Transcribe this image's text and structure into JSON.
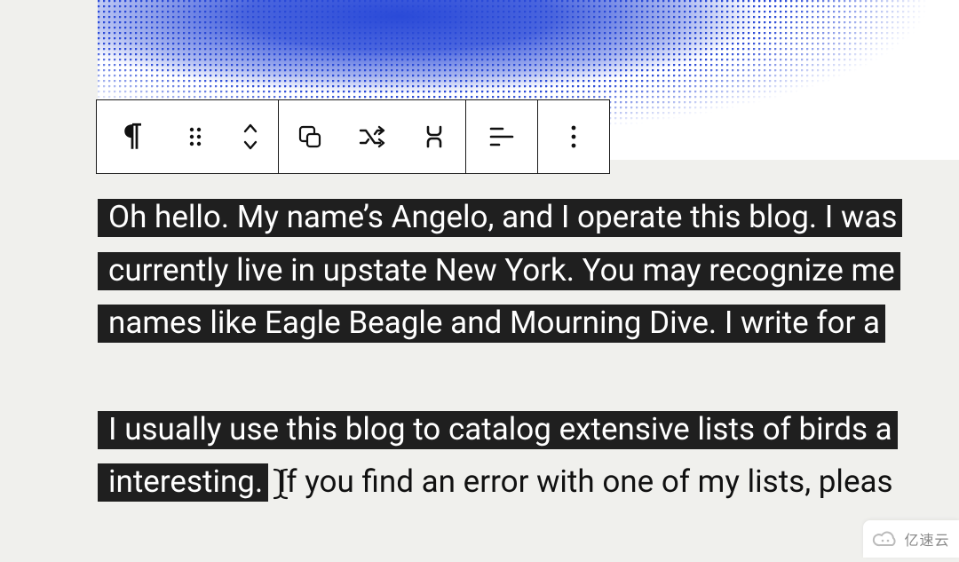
{
  "toolbar": {
    "block_type_icon": "pilcrow",
    "drag_icon": "drag-handle",
    "move_icon": "move-updown",
    "transform_icon": "group",
    "shuffle_icon": "shuffle",
    "split_icon": "split",
    "align_icon": "align-left",
    "more_icon": "more-vertical"
  },
  "content": {
    "paragraphs": [
      {
        "lines": [
          {
            "selected": "Oh hello. My name’s Angelo, and I operate this blog. I was",
            "unselected": ""
          },
          {
            "selected": "currently live in upstate New York. You may recognize me",
            "unselected": ""
          },
          {
            "selected": "names like Eagle Beagle and Mourning Dive. I write for a ",
            "unselected": ""
          }
        ]
      },
      {
        "lines": [
          {
            "selected": "I usually use this blog to catalog extensive lists of birds a",
            "unselected": ""
          },
          {
            "selected": "interesting.",
            "unselected": " If you find an error with one of my lists, pleas"
          }
        ]
      }
    ]
  },
  "watermark": {
    "label": "亿速云"
  }
}
